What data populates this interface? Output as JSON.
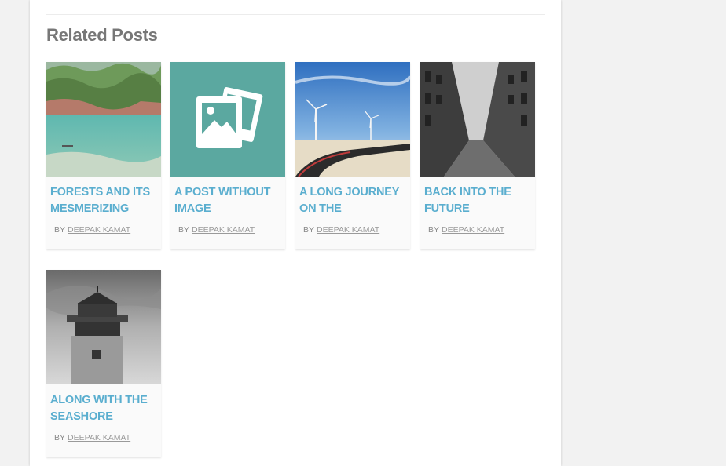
{
  "section": {
    "title": "Related Posts"
  },
  "posts": [
    {
      "title": "Forests and its mesmerizing",
      "by": "By",
      "author": "Deepak Kamat",
      "thumbnail": "forest-lake-photo"
    },
    {
      "title": "A post without image",
      "by": "By",
      "author": "Deepak Kamat",
      "thumbnail": "image-placeholder-icon"
    },
    {
      "title": "A long journey on the",
      "by": "By",
      "author": "Deepak Kamat",
      "thumbnail": "wind-turbines-road-photo"
    },
    {
      "title": "Back into the future",
      "by": "By",
      "author": "Deepak Kamat",
      "thumbnail": "city-street-photo"
    },
    {
      "title": "Along with the seashore",
      "by": "By",
      "author": "Deepak Kamat",
      "thumbnail": "lighthouse-photo"
    }
  ],
  "colors": {
    "accent_title": "#5aaecf",
    "placeholder_bg": "#5ba8a0",
    "heading": "#777777"
  }
}
